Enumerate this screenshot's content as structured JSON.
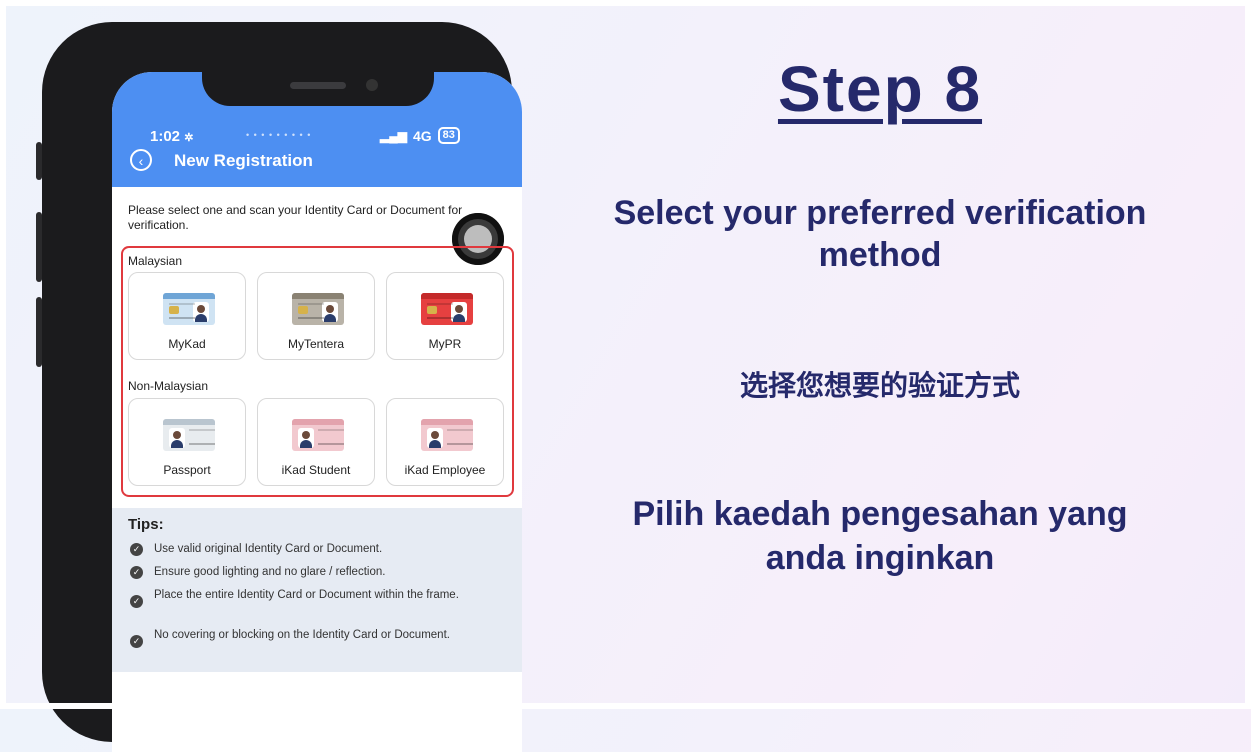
{
  "status_bar": {
    "time": "1:02",
    "carrier_text": "• • • • • • • • •",
    "network": "4G",
    "battery": "83"
  },
  "header": {
    "title": "New Registration"
  },
  "instruction": "Please select one and scan your Identity Card or Document for verification.",
  "groups": {
    "malaysian_label": "Malaysian",
    "non_malaysian_label": "Non-Malaysian"
  },
  "options": {
    "mykad": "MyKad",
    "mytentera": "MyTentera",
    "mypr": "MyPR",
    "passport": "Passport",
    "ikad_student": "iKad Student",
    "ikad_employee": "iKad Employee"
  },
  "tips": {
    "title": "Tips:",
    "items": [
      "Use valid original Identity Card or Document.",
      "Ensure good lighting and no glare / reflection.",
      "Place the entire Identity Card or Document within the frame.",
      "No covering or blocking on the Identity Card or Document."
    ]
  },
  "slide": {
    "step_title": "Step 8",
    "english": "Select your preferred verification method",
    "chinese": "选择您想要的验证方式",
    "malay": "Pilih kaedah pengesahan yang anda inginkan"
  },
  "colors": {
    "header_blue": "#4d8ff2",
    "slide_text": "#25296b",
    "highlight_red": "#e0393e"
  }
}
